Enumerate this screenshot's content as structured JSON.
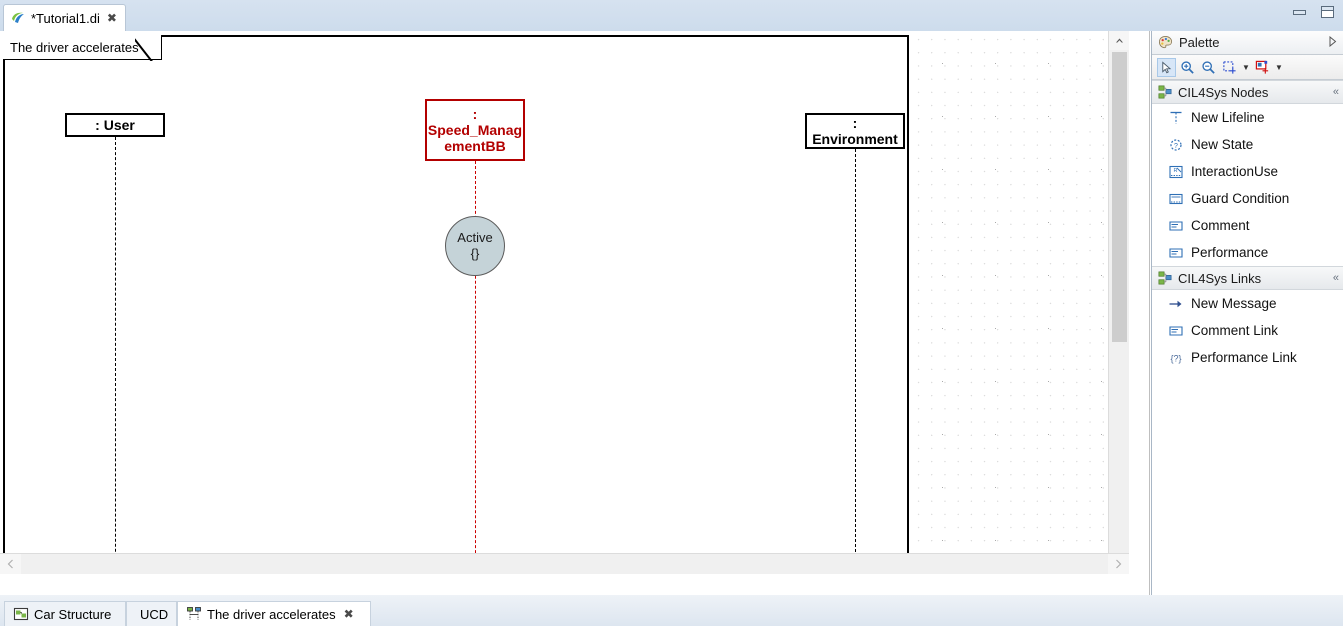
{
  "window": {
    "minimize_label": "Minimize",
    "maximize_label": "Maximize"
  },
  "editor_tab": {
    "title": "*Tutorial1.di",
    "icon": "papyrus-icon",
    "close_icon": "close-icon"
  },
  "diagram": {
    "frame_label": "The driver accelerates",
    "lifelines": [
      {
        "name": ": User",
        "line1": ": User",
        "line2": "",
        "color": "#000000"
      },
      {
        "name": "Speed_ManagementBB",
        "line1": ":",
        "line2": "Speed_Manag",
        "line3": "ementBB",
        "color": "#b30000"
      },
      {
        "name": "Environment",
        "line1": ":",
        "line2": "Environment",
        "color": "#000000"
      }
    ],
    "state": {
      "label": "Active",
      "body": "{}"
    }
  },
  "scrollbars": {
    "v_up": "▲",
    "v_down": "▼",
    "h_left": "‹",
    "h_right": "›"
  },
  "palette": {
    "title": "Palette",
    "expand_icon": "triangle-right-icon",
    "palette_icon": "palette-icon",
    "toolbar": [
      {
        "name": "select-tool",
        "icon": "arrow-cursor-icon"
      },
      {
        "name": "zoom-in-tool",
        "icon": "zoom-in-icon"
      },
      {
        "name": "zoom-out-tool",
        "icon": "zoom-out-icon"
      },
      {
        "name": "marquee-tool",
        "icon": "marquee-select-icon"
      },
      {
        "name": "node-tool",
        "icon": "add-node-icon"
      }
    ],
    "sections": [
      {
        "title": "CIL4Sys Nodes",
        "icon": "nodes-icon",
        "collapse_icon": "double-chevron-icon",
        "items": [
          {
            "label": "New Lifeline",
            "icon": "lifeline-icon"
          },
          {
            "label": "New State",
            "icon": "state-icon"
          },
          {
            "label": "InteractionUse",
            "icon": "interaction-use-icon"
          },
          {
            "label": "Guard Condition",
            "icon": "guard-condition-icon"
          },
          {
            "label": "Comment",
            "icon": "comment-icon"
          },
          {
            "label": "Performance",
            "icon": "performance-icon"
          }
        ]
      },
      {
        "title": "CIL4Sys Links",
        "icon": "links-icon",
        "collapse_icon": "double-chevron-icon",
        "items": [
          {
            "label": "New Message",
            "icon": "arrow-right-icon"
          },
          {
            "label": "Comment Link",
            "icon": "comment-link-icon"
          },
          {
            "label": "Performance Link",
            "icon": "performance-link-icon"
          }
        ]
      }
    ]
  },
  "bottom_tabs": [
    {
      "label": "Car Structure",
      "icon": "structure-diagram-icon",
      "active": false,
      "closable": false
    },
    {
      "label": "UCD",
      "icon": "usecase-diagram-icon",
      "active": false,
      "closable": false
    },
    {
      "label": "The driver accelerates",
      "icon": "sequence-diagram-icon",
      "active": true,
      "closable": true,
      "close_icon": "close-icon"
    }
  ]
}
